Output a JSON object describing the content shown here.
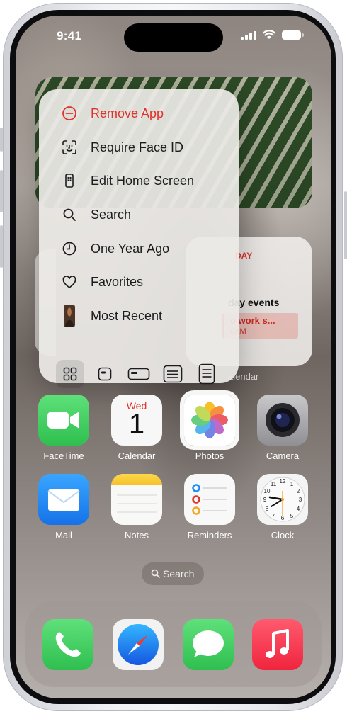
{
  "status_bar": {
    "time": "9:41"
  },
  "widgets": {
    "calendar": {
      "day_partial": "DAY",
      "events_partial": "day events",
      "event_title_partial": "o work s...",
      "event_time_partial": "0AM",
      "label_partial": "alendar"
    }
  },
  "context_menu": {
    "items": [
      {
        "label": "Remove App",
        "icon": "minus-circle-icon",
        "color": "#e0322b"
      },
      {
        "label": "Require Face ID",
        "icon": "face-id-icon"
      },
      {
        "label": "Edit Home Screen",
        "icon": "phone-icon"
      },
      {
        "label": "Search",
        "icon": "magnifier-icon"
      },
      {
        "label": "One Year Ago",
        "icon": "clock-icon"
      },
      {
        "label": "Favorites",
        "icon": "heart-icon"
      },
      {
        "label": "Most Recent",
        "icon": "photo-thumbnail"
      }
    ],
    "widget_sizes": [
      "app-icon-only",
      "small",
      "medium",
      "large",
      "extra-large"
    ],
    "selected_size": "app-icon-only"
  },
  "apps": [
    {
      "name": "FaceTime",
      "icon": "facetime-icon"
    },
    {
      "name": "Calendar",
      "icon": "calendar-icon",
      "weekday": "Wed",
      "day": "1"
    },
    {
      "name": "Photos",
      "icon": "photos-icon"
    },
    {
      "name": "Camera",
      "icon": "camera-icon"
    },
    {
      "name": "Mail",
      "icon": "mail-icon"
    },
    {
      "name": "Notes",
      "icon": "notes-icon"
    },
    {
      "name": "Reminders",
      "icon": "reminders-icon"
    },
    {
      "name": "Clock",
      "icon": "clock-app-icon"
    }
  ],
  "search_pill": {
    "label": "Search"
  },
  "dock": [
    {
      "name": "Phone",
      "icon": "phone-app-icon"
    },
    {
      "name": "Safari",
      "icon": "safari-icon"
    },
    {
      "name": "Messages",
      "icon": "messages-icon"
    },
    {
      "name": "Music",
      "icon": "music-icon"
    }
  ],
  "colors": {
    "accent_red": "#e0322b",
    "facetime_green": "#34c759",
    "mail_blue": "#1d8cf8",
    "music_red": "#fa2d48"
  }
}
